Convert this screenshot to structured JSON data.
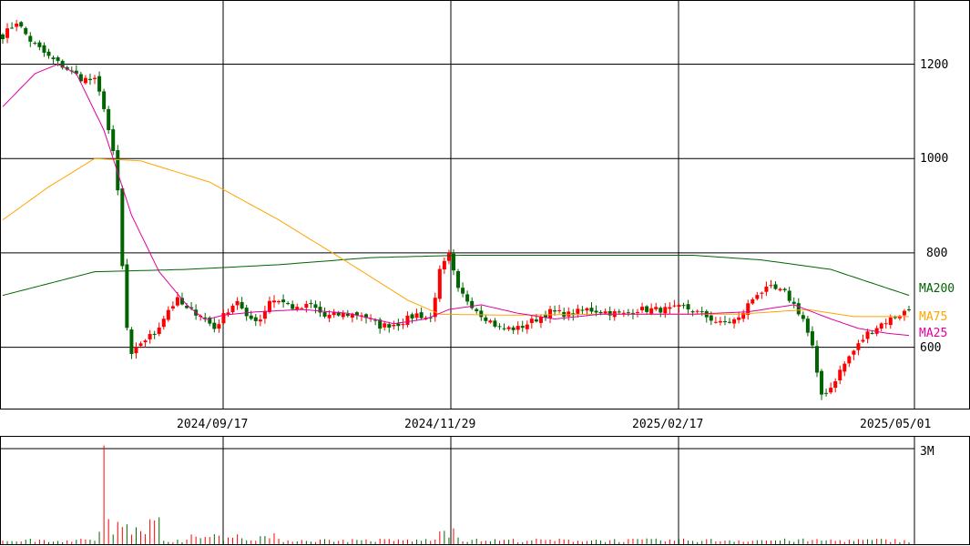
{
  "chart_data": {
    "type": "candlestick",
    "price_axis": {
      "ticks": [
        600,
        800,
        1000,
        1200
      ],
      "ylim": [
        470,
        1330
      ]
    },
    "date_axis": {
      "tick_labels": [
        "2024/09/17",
        "2024/11/29",
        "2025/02/17",
        "2025/05/01"
      ]
    },
    "volume_axis": {
      "tick_labels": [
        "3M"
      ],
      "tick_value": 3000000
    },
    "moving_average_labels": {
      "ma200": "MA200",
      "ma75": "MA75",
      "ma25": "MA25"
    },
    "colors": {
      "up": "#ff0000",
      "down": "#006400",
      "ma200": "#006400",
      "ma75": "#ffa500",
      "ma25": "#e000a0",
      "grid": "#000000"
    },
    "approx_close_path": [
      [
        0,
        1260
      ],
      [
        3,
        1290
      ],
      [
        6,
        1250
      ],
      [
        10,
        1215
      ],
      [
        14,
        1190
      ],
      [
        17,
        1170
      ],
      [
        20,
        1165
      ],
      [
        22,
        1110
      ],
      [
        24,
        1010
      ],
      [
        25,
        930
      ],
      [
        26,
        770
      ],
      [
        27,
        640
      ],
      [
        28,
        580
      ],
      [
        30,
        610
      ],
      [
        33,
        630
      ],
      [
        36,
        680
      ],
      [
        38,
        700
      ],
      [
        40,
        680
      ],
      [
        43,
        670
      ],
      [
        46,
        640
      ],
      [
        49,
        680
      ],
      [
        51,
        700
      ],
      [
        53,
        660
      ],
      [
        56,
        660
      ],
      [
        58,
        700
      ],
      [
        60,
        700
      ],
      [
        62,
        690
      ],
      [
        64,
        680
      ],
      [
        67,
        690
      ],
      [
        70,
        665
      ],
      [
        74,
        670
      ],
      [
        78,
        670
      ],
      [
        82,
        645
      ],
      [
        86,
        650
      ],
      [
        90,
        670
      ],
      [
        93,
        660
      ],
      [
        95,
        760
      ],
      [
        97,
        795
      ],
      [
        99,
        720
      ],
      [
        101,
        700
      ],
      [
        104,
        670
      ],
      [
        108,
        640
      ],
      [
        112,
        640
      ],
      [
        116,
        660
      ],
      [
        119,
        675
      ],
      [
        123,
        670
      ],
      [
        127,
        680
      ],
      [
        131,
        675
      ],
      [
        135,
        670
      ],
      [
        138,
        680
      ],
      [
        141,
        680
      ],
      [
        145,
        680
      ],
      [
        148,
        685
      ],
      [
        152,
        670
      ],
      [
        156,
        650
      ],
      [
        160,
        660
      ],
      [
        162,
        690
      ],
      [
        164,
        715
      ],
      [
        167,
        725
      ],
      [
        170,
        715
      ],
      [
        172,
        690
      ],
      [
        174,
        660
      ],
      [
        176,
        600
      ],
      [
        177,
        540
      ],
      [
        178,
        500
      ],
      [
        180,
        515
      ],
      [
        182,
        550
      ],
      [
        184,
        580
      ],
      [
        186,
        605
      ],
      [
        188,
        630
      ],
      [
        191,
        650
      ],
      [
        194,
        665
      ],
      [
        197,
        680
      ]
    ],
    "approx_ma200_path": [
      [
        0,
        710
      ],
      [
        10,
        735
      ],
      [
        20,
        760
      ],
      [
        40,
        765
      ],
      [
        60,
        775
      ],
      [
        80,
        790
      ],
      [
        100,
        795
      ],
      [
        130,
        795
      ],
      [
        150,
        795
      ],
      [
        165,
        785
      ],
      [
        180,
        765
      ],
      [
        197,
        710
      ]
    ],
    "approx_ma75_path": [
      [
        0,
        870
      ],
      [
        10,
        940
      ],
      [
        20,
        1000
      ],
      [
        30,
        995
      ],
      [
        45,
        950
      ],
      [
        60,
        870
      ],
      [
        75,
        780
      ],
      [
        88,
        700
      ],
      [
        95,
        670
      ],
      [
        110,
        668
      ],
      [
        130,
        670
      ],
      [
        160,
        670
      ],
      [
        175,
        680
      ],
      [
        185,
        665
      ],
      [
        197,
        665
      ]
    ],
    "approx_ma25_path": [
      [
        0,
        1110
      ],
      [
        7,
        1180
      ],
      [
        12,
        1200
      ],
      [
        16,
        1180
      ],
      [
        22,
        1060
      ],
      [
        28,
        880
      ],
      [
        34,
        760
      ],
      [
        40,
        690
      ],
      [
        44,
        658
      ],
      [
        48,
        668
      ],
      [
        55,
        675
      ],
      [
        65,
        680
      ],
      [
        75,
        672
      ],
      [
        85,
        650
      ],
      [
        92,
        660
      ],
      [
        97,
        680
      ],
      [
        104,
        690
      ],
      [
        112,
        672
      ],
      [
        120,
        660
      ],
      [
        130,
        670
      ],
      [
        150,
        670
      ],
      [
        162,
        675
      ],
      [
        172,
        690
      ],
      [
        180,
        660
      ],
      [
        186,
        640
      ],
      [
        192,
        630
      ],
      [
        197,
        625
      ]
    ],
    "volume_spike_index": 22
  }
}
